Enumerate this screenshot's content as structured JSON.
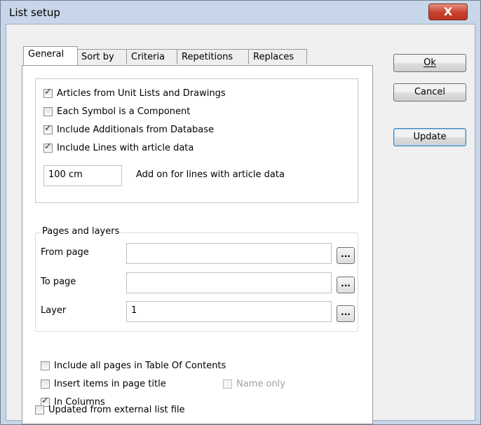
{
  "window": {
    "title": "List setup",
    "close_symbol": "X"
  },
  "tabs": [
    {
      "label": "General",
      "active": true
    },
    {
      "label": "Sort by"
    },
    {
      "label": "Criteria"
    },
    {
      "label": "Repetitions"
    },
    {
      "label": "Replaces"
    }
  ],
  "general": {
    "options": [
      {
        "label": "Articles from Unit Lists and Drawings",
        "checked": true
      },
      {
        "label": "Each Symbol is a Component",
        "checked": false
      },
      {
        "label": "Include Additionals from Database",
        "checked": true
      },
      {
        "label": "Include Lines with article data",
        "checked": true
      }
    ],
    "addon_value": "100 cm",
    "addon_label": "Add on for lines with article data",
    "pages_group_title": "Pages and layers",
    "from_page_label": "From page",
    "from_page_value": "",
    "to_page_label": "To page",
    "to_page_value": "",
    "layer_label": "Layer",
    "layer_value": "1",
    "browse_label": "...",
    "toc_label": "Include all pages in Table Of Contents",
    "toc_checked": false,
    "insert_title_label": "Insert items in page title",
    "insert_title_checked": false,
    "name_only_label": "Name only",
    "name_only_checked": false,
    "in_columns_label": "In Columns",
    "in_columns_checked": true,
    "external_label": "Updated from external list file",
    "external_checked": false
  },
  "buttons": {
    "ok": "Ok",
    "cancel": "Cancel",
    "update": "Update"
  }
}
